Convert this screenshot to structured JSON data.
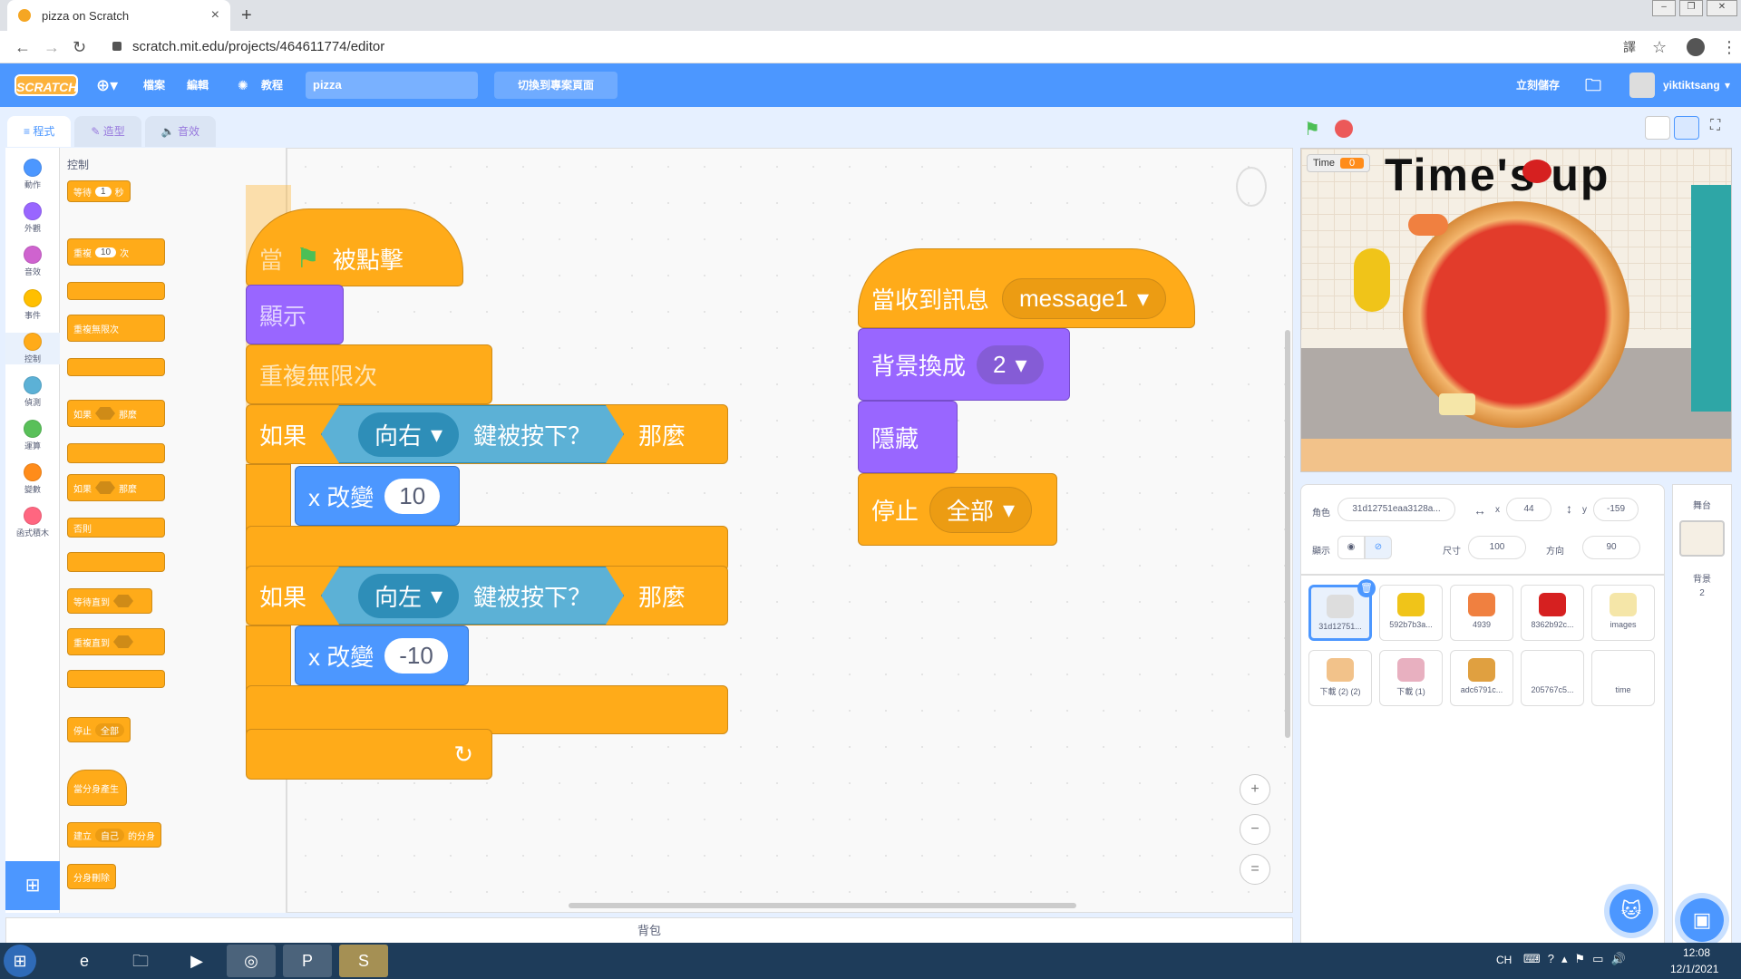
{
  "browser": {
    "tab_title": "pizza on Scratch",
    "url": "scratch.mit.edu/projects/464611774/editor"
  },
  "menubar": {
    "logo": "SCRATCH",
    "file": "檔案",
    "edit": "編輯",
    "tutorials": "教程",
    "project_name": "pizza",
    "switch_label": "切換到專案頁面",
    "save_now": "立刻儲存",
    "username": "yiktiktsang"
  },
  "editor_tabs": [
    "程式",
    "造型",
    "音效"
  ],
  "categories": [
    {
      "label": "動作",
      "color": "#4c97ff"
    },
    {
      "label": "外觀",
      "color": "#9966ff"
    },
    {
      "label": "音效",
      "color": "#cf63cf"
    },
    {
      "label": "事件",
      "color": "#ffbf00"
    },
    {
      "label": "控制",
      "color": "#ffab19"
    },
    {
      "label": "偵測",
      "color": "#5cb1d6"
    },
    {
      "label": "運算",
      "color": "#59c059"
    },
    {
      "label": "變數",
      "color": "#ff8c1a"
    },
    {
      "label": "函式積木",
      "color": "#ff6680"
    }
  ],
  "palette": {
    "heading": "控制",
    "wait": "等待",
    "wait_val": "1",
    "wait_unit": "秒",
    "repeat": "重複",
    "repeat_val": "10",
    "repeat_unit": "次",
    "forever": "重複無限次",
    "if": "如果",
    "then": "那麼",
    "else": "否則",
    "wait_until": "等待直到",
    "repeat_until": "重複直到",
    "stop": "停止",
    "stop_val": "全部",
    "clone_start": "當分身產生",
    "create_clone": "建立",
    "clone_target": "自己",
    "clone_of": "的分身",
    "delete_clone": "分身刪除"
  },
  "script1": {
    "when": "當",
    "clicked": "被點擊",
    "show": "顯示",
    "forever": "重複無限次",
    "if1": "如果",
    "key1": "向右",
    "key_pressed": "鍵被按下？",
    "then": "那麼",
    "change_x": "x 改變",
    "val1": "10",
    "if2": "如果",
    "key2": "向左",
    "val2": "-10"
  },
  "script2": {
    "when_receive": "當收到訊息",
    "message": "message1",
    "switch_backdrop": "背景換成",
    "backdrop": "2",
    "hide": "隱藏",
    "stop": "停止",
    "stop_val": "全部"
  },
  "backpack": "背包",
  "stage": {
    "var_name": "Time",
    "var_value": "0",
    "banner": "Time's up"
  },
  "sprite_info": {
    "sprite_label": "角色",
    "sprite_name": "31d12751eaa3128a...",
    "x_label": "x",
    "x": "44",
    "y_label": "y",
    "y": "-159",
    "show_label": "顯示",
    "size_label": "尺寸",
    "size": "100",
    "dir_label": "方向",
    "direction": "90"
  },
  "sprites": [
    "31d12751...",
    "592b7b3a...",
    "4939",
    "8362b92c...",
    "images",
    "下載 (2) (2)",
    "下載 (1)",
    "adc6791c...",
    "205767c5...",
    "time"
  ],
  "stage_panel": {
    "title": "舞台",
    "backdrop_label": "背景",
    "backdrop_count": "2"
  },
  "taskbar": {
    "ime": "CH",
    "time": "12:08",
    "date": "12/1/2021"
  }
}
